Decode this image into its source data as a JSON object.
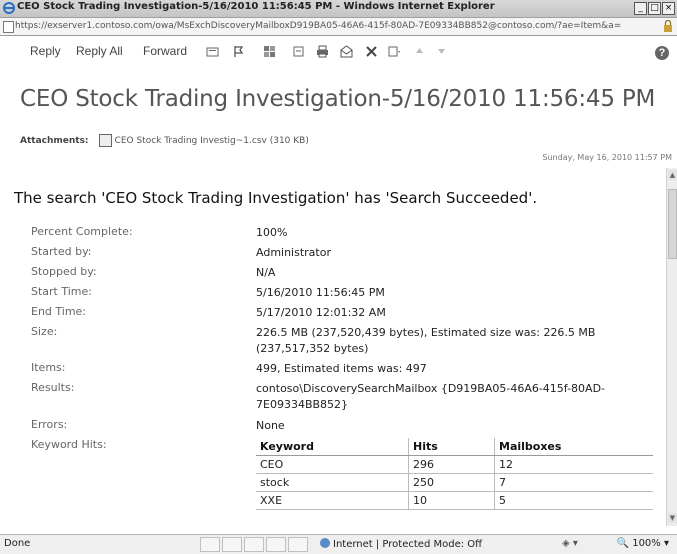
{
  "window": {
    "title": "CEO Stock Trading Investigation-5/16/2010 11:56:45 PM - Windows Internet Explorer",
    "minimize": "_",
    "maximize": "□",
    "close": "×"
  },
  "address": {
    "prefix": "https://exserver1.",
    "domain": "contoso.com",
    "rest": "/owa/?ae=Item&a=Open&t=IPM.Note&id=RgAAAAAP8bKl%2bGmsfa1eD7b5w7bkBwCPXHQKrU0%2fQ5T4D0MzJKLIAAAAXIaRAAB4%2fmH0ZQrmRJLv1A0QAAAA"
  },
  "address_display": "https://exserver1.contoso.com/owa/MsExchDiscoveryMailboxD919BA05-46A6-415f-80AD-7E09334BB852@contoso.com/?ae=Item&a=",
  "toolbar": {
    "reply": "Reply",
    "reply_all": "Reply All",
    "forward": "Forward",
    "help": "?"
  },
  "message": {
    "subject": "CEO Stock Trading Investigation-5/16/2010 11:56:45 PM",
    "attachments_label": "Attachments:",
    "attachment_name": "CEO Stock Trading Investig~1.csv (310 KB)",
    "sent": "Sunday, May 16, 2010 11:57 PM",
    "heading": "The search 'CEO Stock Trading Investigation' has 'Search Succeeded'."
  },
  "details": [
    {
      "key": "Percent Complete:",
      "value": "100%"
    },
    {
      "key": "Started by:",
      "value": "Administrator"
    },
    {
      "key": "Stopped by:",
      "value": "N/A"
    },
    {
      "key": "Start Time:",
      "value": "5/16/2010 11:56:45 PM"
    },
    {
      "key": "End Time:",
      "value": "5/17/2010 12:01:32 AM"
    },
    {
      "key": "Size:",
      "value": "226.5 MB (237,520,439 bytes), Estimated size was: 226.5 MB (237,517,352 bytes)"
    },
    {
      "key": "Items:",
      "value": "499, Estimated items was: 497"
    },
    {
      "key": "Results:",
      "value": "contoso\\DiscoverySearchMailbox {D919BA05-46A6-415f-80AD-7E09334BB852}"
    },
    {
      "key": "Errors:",
      "value": "None"
    },
    {
      "key": "Keyword Hits:",
      "value": ""
    }
  ],
  "keyword_table": {
    "headers": [
      "Keyword",
      "Hits",
      "Mailboxes"
    ],
    "rows": [
      [
        "CEO",
        "296",
        "12"
      ],
      [
        "stock",
        "250",
        "7"
      ],
      [
        "XXE",
        "10",
        "5"
      ]
    ]
  },
  "status": {
    "done": "Done",
    "zone": "Internet | Protected Mode: Off",
    "zoom": "100%"
  }
}
